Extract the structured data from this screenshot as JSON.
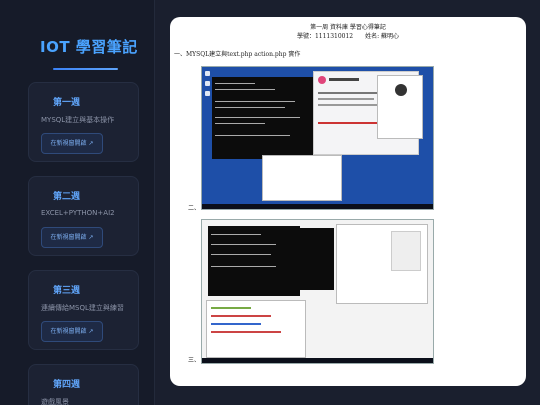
{
  "sidebar": {
    "brand": "IOT 學習筆記",
    "weeks": [
      {
        "title": "第一週",
        "desc": "MYSQL建立與基本操作",
        "btn": "在新視窗開啟 ↗"
      },
      {
        "title": "第二週",
        "desc": "EXCEL+PYTHON+AI2",
        "btn": "在新視窗開啟 ↗"
      },
      {
        "title": "第三週",
        "desc": "連續傳給MSQL建立與練習",
        "btn": "在新視窗開啟 ↗"
      },
      {
        "title": "第四週",
        "desc": "遊戲風景",
        "btn": ""
      }
    ]
  },
  "doc": {
    "title": "第一周 資料庫 學習心得筆記",
    "subtitle": "學號：1111310012　　姓名: 蘇明心",
    "section1": "一、MYSQL建立與text.php action.php 實作",
    "section2": "二、",
    "section3": "三、"
  },
  "colors": {
    "background": "#1a1f2e",
    "accent": "#4aa3ff",
    "card": "#1c2233",
    "content": "#ffffff"
  }
}
